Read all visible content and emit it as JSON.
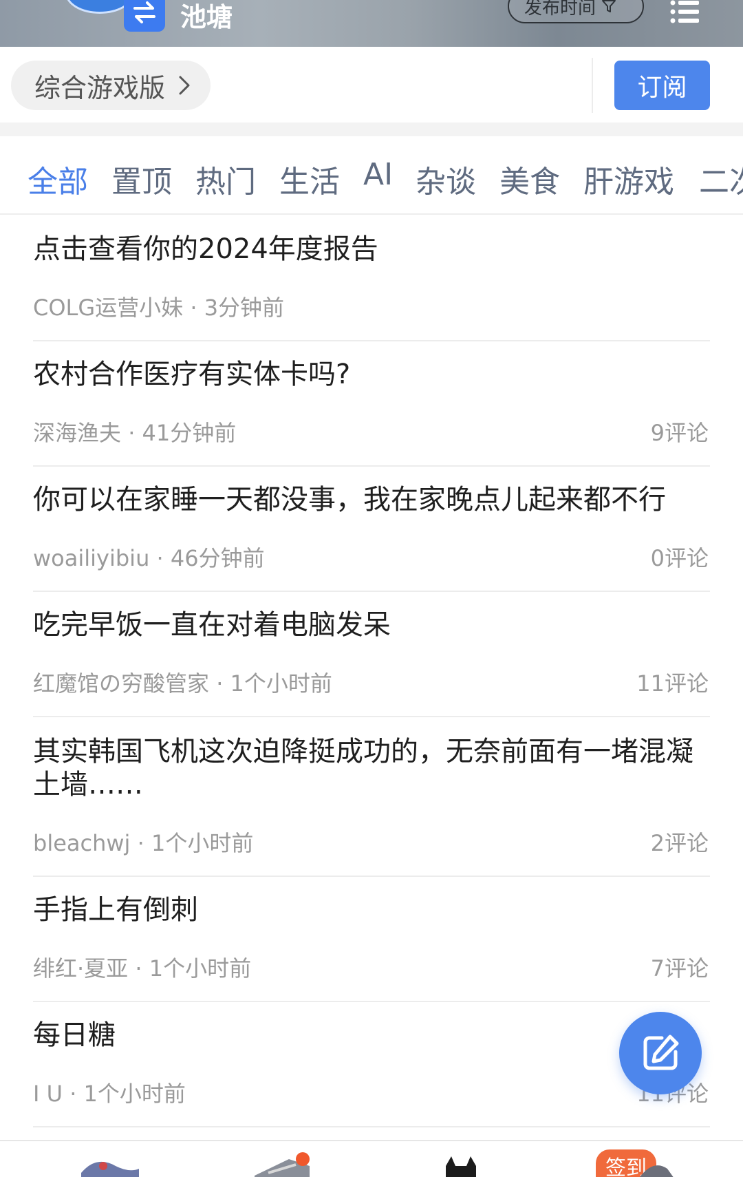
{
  "header": {
    "title": "池塘",
    "sort_label": "发布时间",
    "icons": {
      "switch": "swap-arrows-icon",
      "filter": "filter-funnel-icon",
      "menu": "menu-list-icon"
    }
  },
  "board": {
    "name": "综合游戏版",
    "subscribe_label": "订阅"
  },
  "tabs": [
    {
      "label": "全部",
      "active": true
    },
    {
      "label": "置顶"
    },
    {
      "label": "热门"
    },
    {
      "label": "生活"
    },
    {
      "label": "AI"
    },
    {
      "label": "杂谈"
    },
    {
      "label": "美食"
    },
    {
      "label": "肝游戏"
    },
    {
      "label": "二次"
    }
  ],
  "posts": [
    {
      "title": "点击查看你的2024年度报告",
      "author": "COLG运营小妹",
      "time": "3分钟前",
      "comments": ""
    },
    {
      "title": "农村合作医疗有实体卡吗?",
      "author": "深海渔夫",
      "time": "41分钟前",
      "comments": "9评论"
    },
    {
      "title": "你可以在家睡一天都没事，我在家晚点儿起来都不行",
      "author": "woailiyibiu",
      "time": "46分钟前",
      "comments": "0评论"
    },
    {
      "title": "吃完早饭一直在对着电脑发呆",
      "author": "红魔馆の穷酸管家",
      "time": "1个小时前",
      "comments": "11评论"
    },
    {
      "title": "其实韩国飞机这次迫降挺成功的，无奈前面有一堵混凝土墙……",
      "author": "bleachwj",
      "time": "1个小时前",
      "comments": "2评论"
    },
    {
      "title": "手指上有倒刺",
      "author": "绯红·夏亚",
      "time": "1个小时前",
      "comments": "7评论"
    },
    {
      "title": "每日糖",
      "author": "I U",
      "time": "1个小时前",
      "comments": "11评论"
    }
  ],
  "fab": {
    "icon": "edit-pencil-icon"
  },
  "bottom_nav": {
    "checkin_label": "签到"
  },
  "colors": {
    "accent": "#4d86ec",
    "active_tab": "#4a7fe8",
    "badge": "#f06a3c"
  }
}
